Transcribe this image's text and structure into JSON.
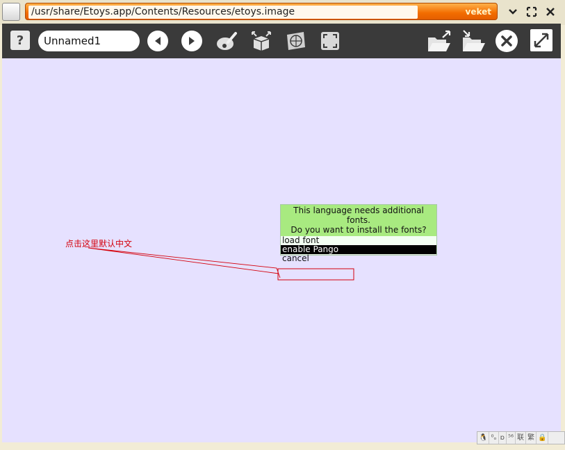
{
  "window": {
    "title_path": "/usr/share/Etoys.app/Contents/Resources/etoys.image",
    "brand": "veket"
  },
  "toolbar": {
    "help_label": "?",
    "project_name": "Unnamed1"
  },
  "annotation": {
    "text": "点击这里默认中文"
  },
  "menu": {
    "header_line1": "This language needs additional fonts.",
    "header_line2": "Do you want to install the fonts?",
    "items": [
      {
        "label": "load font",
        "selected": false
      },
      {
        "label": "enable Pango",
        "selected": true
      },
      {
        "label": "cancel",
        "selected": false
      }
    ]
  },
  "tray": {
    "cells": [
      "🐧",
      "⁰ₒ",
      "ɒ",
      "⁵⁶",
      "联",
      "繁",
      "🔒"
    ]
  },
  "colors": {
    "title_gradient": "#f26d00",
    "toolbar": "#3a3a3a",
    "canvas": "#e6e1ff",
    "menu_header": "#a8ea80",
    "annotation": "#d4000b"
  }
}
